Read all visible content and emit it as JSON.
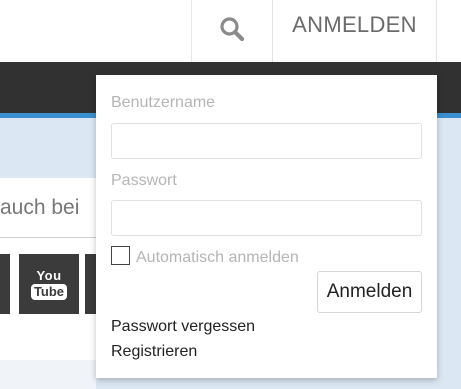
{
  "header": {
    "search_icon": "search-icon",
    "login_tab_label": "ANMELDEN"
  },
  "background": {
    "search_partial_text": "auch bei",
    "social": {
      "youtube_top": "You",
      "youtube_bottom": "Tube"
    }
  },
  "login_form": {
    "username_label": "Benutzername",
    "username_value": "",
    "password_label": "Passwort",
    "password_value": "",
    "remember_label": "Automatisch anmelden",
    "remember_checked": false,
    "submit_label": "Anmelden",
    "forgot_password_link": "Passwort vergessen",
    "register_link": "Registrieren"
  },
  "colors": {
    "dark_bar": "#313131",
    "accent_blue": "#3a8fd0",
    "content_background": "#dbe7f3"
  }
}
